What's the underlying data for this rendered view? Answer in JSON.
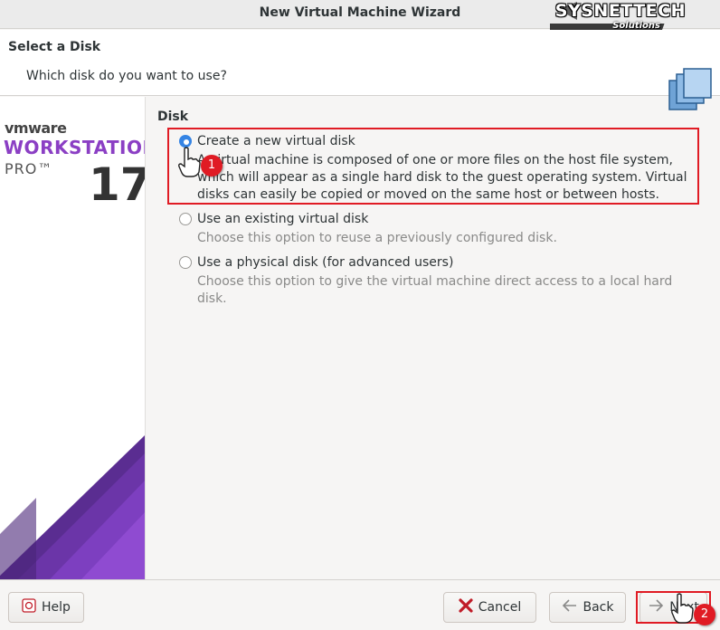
{
  "window": {
    "title": "New Virtual Machine Wizard"
  },
  "watermark": {
    "main": "SYSNETTECH",
    "sub": "Solutions"
  },
  "header": {
    "title": "Select a Disk",
    "subtitle": "Which disk do you want to use?",
    "icon": "disk-stack-icon"
  },
  "brand": {
    "vendor": "vmware",
    "product": "WORKSTATION",
    "edition": "PRO™",
    "version": "17"
  },
  "disk": {
    "group_label": "Disk",
    "options": [
      {
        "label": "Create a new virtual disk",
        "description": "A virtual machine is composed of one or more files on the host file system, which will appear as a single hard disk to the guest operating system. Virtual disks can easily be copied or moved on the same host or between hosts.",
        "selected": true
      },
      {
        "label": "Use an existing virtual disk",
        "description": "Choose this option to reuse a previously configured disk.",
        "selected": false
      },
      {
        "label": "Use a physical disk (for advanced users)",
        "description": "Choose this option to give the virtual machine direct access to a local hard disk.",
        "selected": false
      }
    ]
  },
  "annotations": {
    "step1": "1",
    "step2": "2"
  },
  "footer": {
    "help_label": "Help",
    "cancel_label": "Cancel",
    "back_label": "Back",
    "next_label": "Next"
  },
  "colors": {
    "accent": "#3584e4",
    "highlight": "#e01b24",
    "brand_purple": "#8b3fc4"
  }
}
